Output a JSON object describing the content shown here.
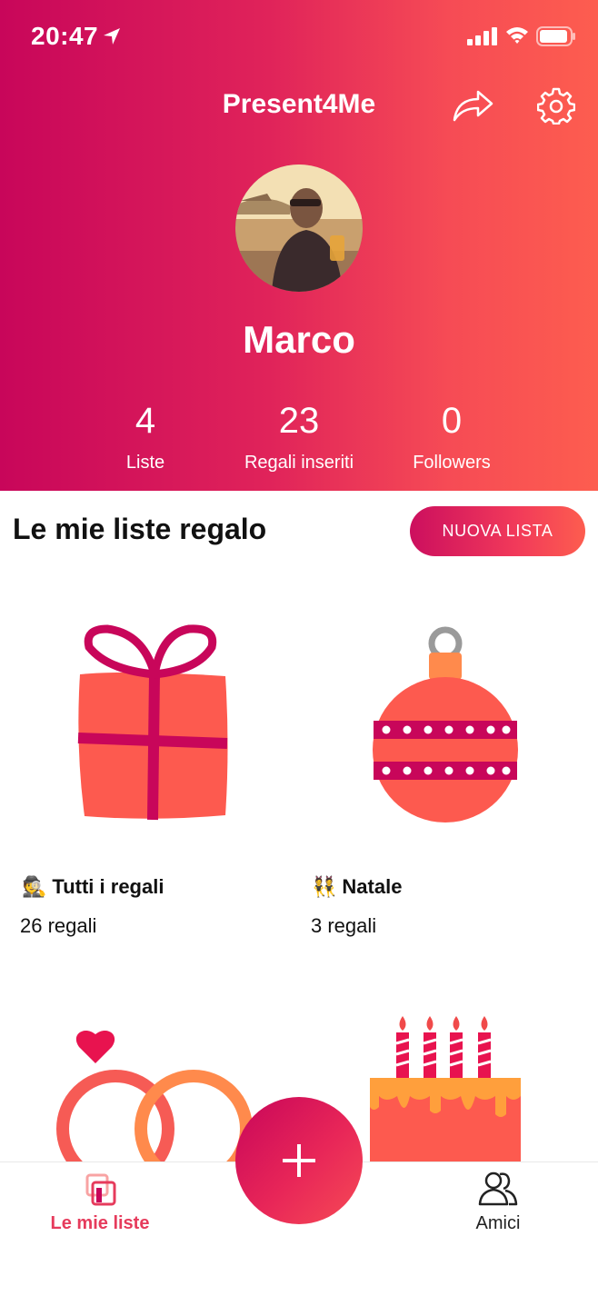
{
  "status": {
    "time": "20:47"
  },
  "header": {
    "title": "Present4Me",
    "share_icon": "share-icon",
    "settings_icon": "gear-icon"
  },
  "profile": {
    "name": "Marco",
    "stats": [
      {
        "value": "4",
        "label": "Liste"
      },
      {
        "value": "23",
        "label": "Regali inseriti"
      },
      {
        "value": "0",
        "label": "Followers"
      }
    ]
  },
  "section": {
    "title": "Le mie liste regalo",
    "new_list_label": "NUOVA LISTA"
  },
  "lists": [
    {
      "emoji": "🕵️",
      "title": "Tutti i regali",
      "count": "26 regali",
      "art": "gift-box"
    },
    {
      "emoji": "👯",
      "title": "Natale",
      "count": "3 regali",
      "art": "christmas-ornament"
    },
    {
      "art": "wedding-rings"
    },
    {
      "art": "birthday-cake"
    }
  ],
  "tabbar": {
    "tabs": [
      {
        "label": "Le mie liste",
        "icon": "lists-icon",
        "active": true
      },
      {
        "label": "Amici",
        "icon": "friends-icon",
        "active": false
      }
    ],
    "fab_icon": "plus-icon"
  },
  "colors": {
    "accent": "#e63b5c",
    "gradient_start": "#c8065a",
    "gradient_end": "#fd5d4f",
    "coral": "#fd5a4f"
  }
}
